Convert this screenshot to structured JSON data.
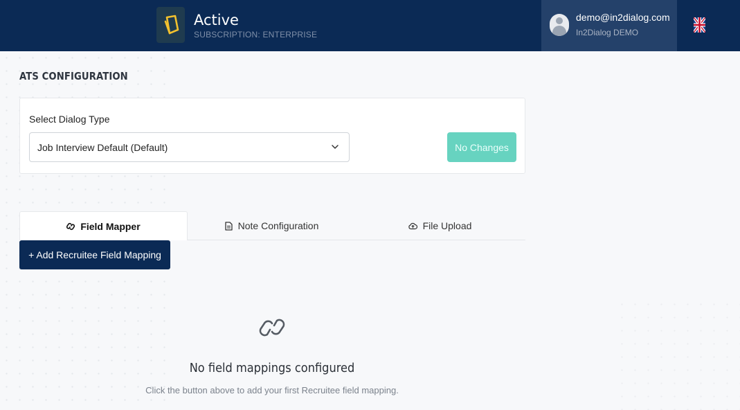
{
  "header": {
    "status_title": "Active",
    "subscription": "SUBSCRIPTION: ENTERPRISE",
    "user_email": "demo@in2dialog.com",
    "user_org": "In2Dialog DEMO",
    "language_icon": "uk-flag-icon",
    "colors": {
      "bar": "#0b2a55",
      "user_area": "#24416a",
      "logo_accent": "#f2c12e"
    }
  },
  "page": {
    "title": "ATS CONFIGURATION"
  },
  "dialog_card": {
    "label": "Select Dialog Type",
    "selected_value": "Job Interview Default (Default)",
    "save_button_label": "No Changes",
    "save_button_color": "#67d3c0"
  },
  "tabs": [
    {
      "label": "Field Mapper",
      "icon": "link-icon",
      "active": true
    },
    {
      "label": "Note Configuration",
      "icon": "document-icon",
      "active": false
    },
    {
      "label": "File Upload",
      "icon": "upload-icon",
      "active": false
    }
  ],
  "field_mapper": {
    "add_button_label": "+ Add Recruitee Field Mapping",
    "empty_icon": "link-icon",
    "empty_title": "No field mappings configured",
    "empty_subtitle": "Click the button above to add your first Recruitee field mapping."
  }
}
